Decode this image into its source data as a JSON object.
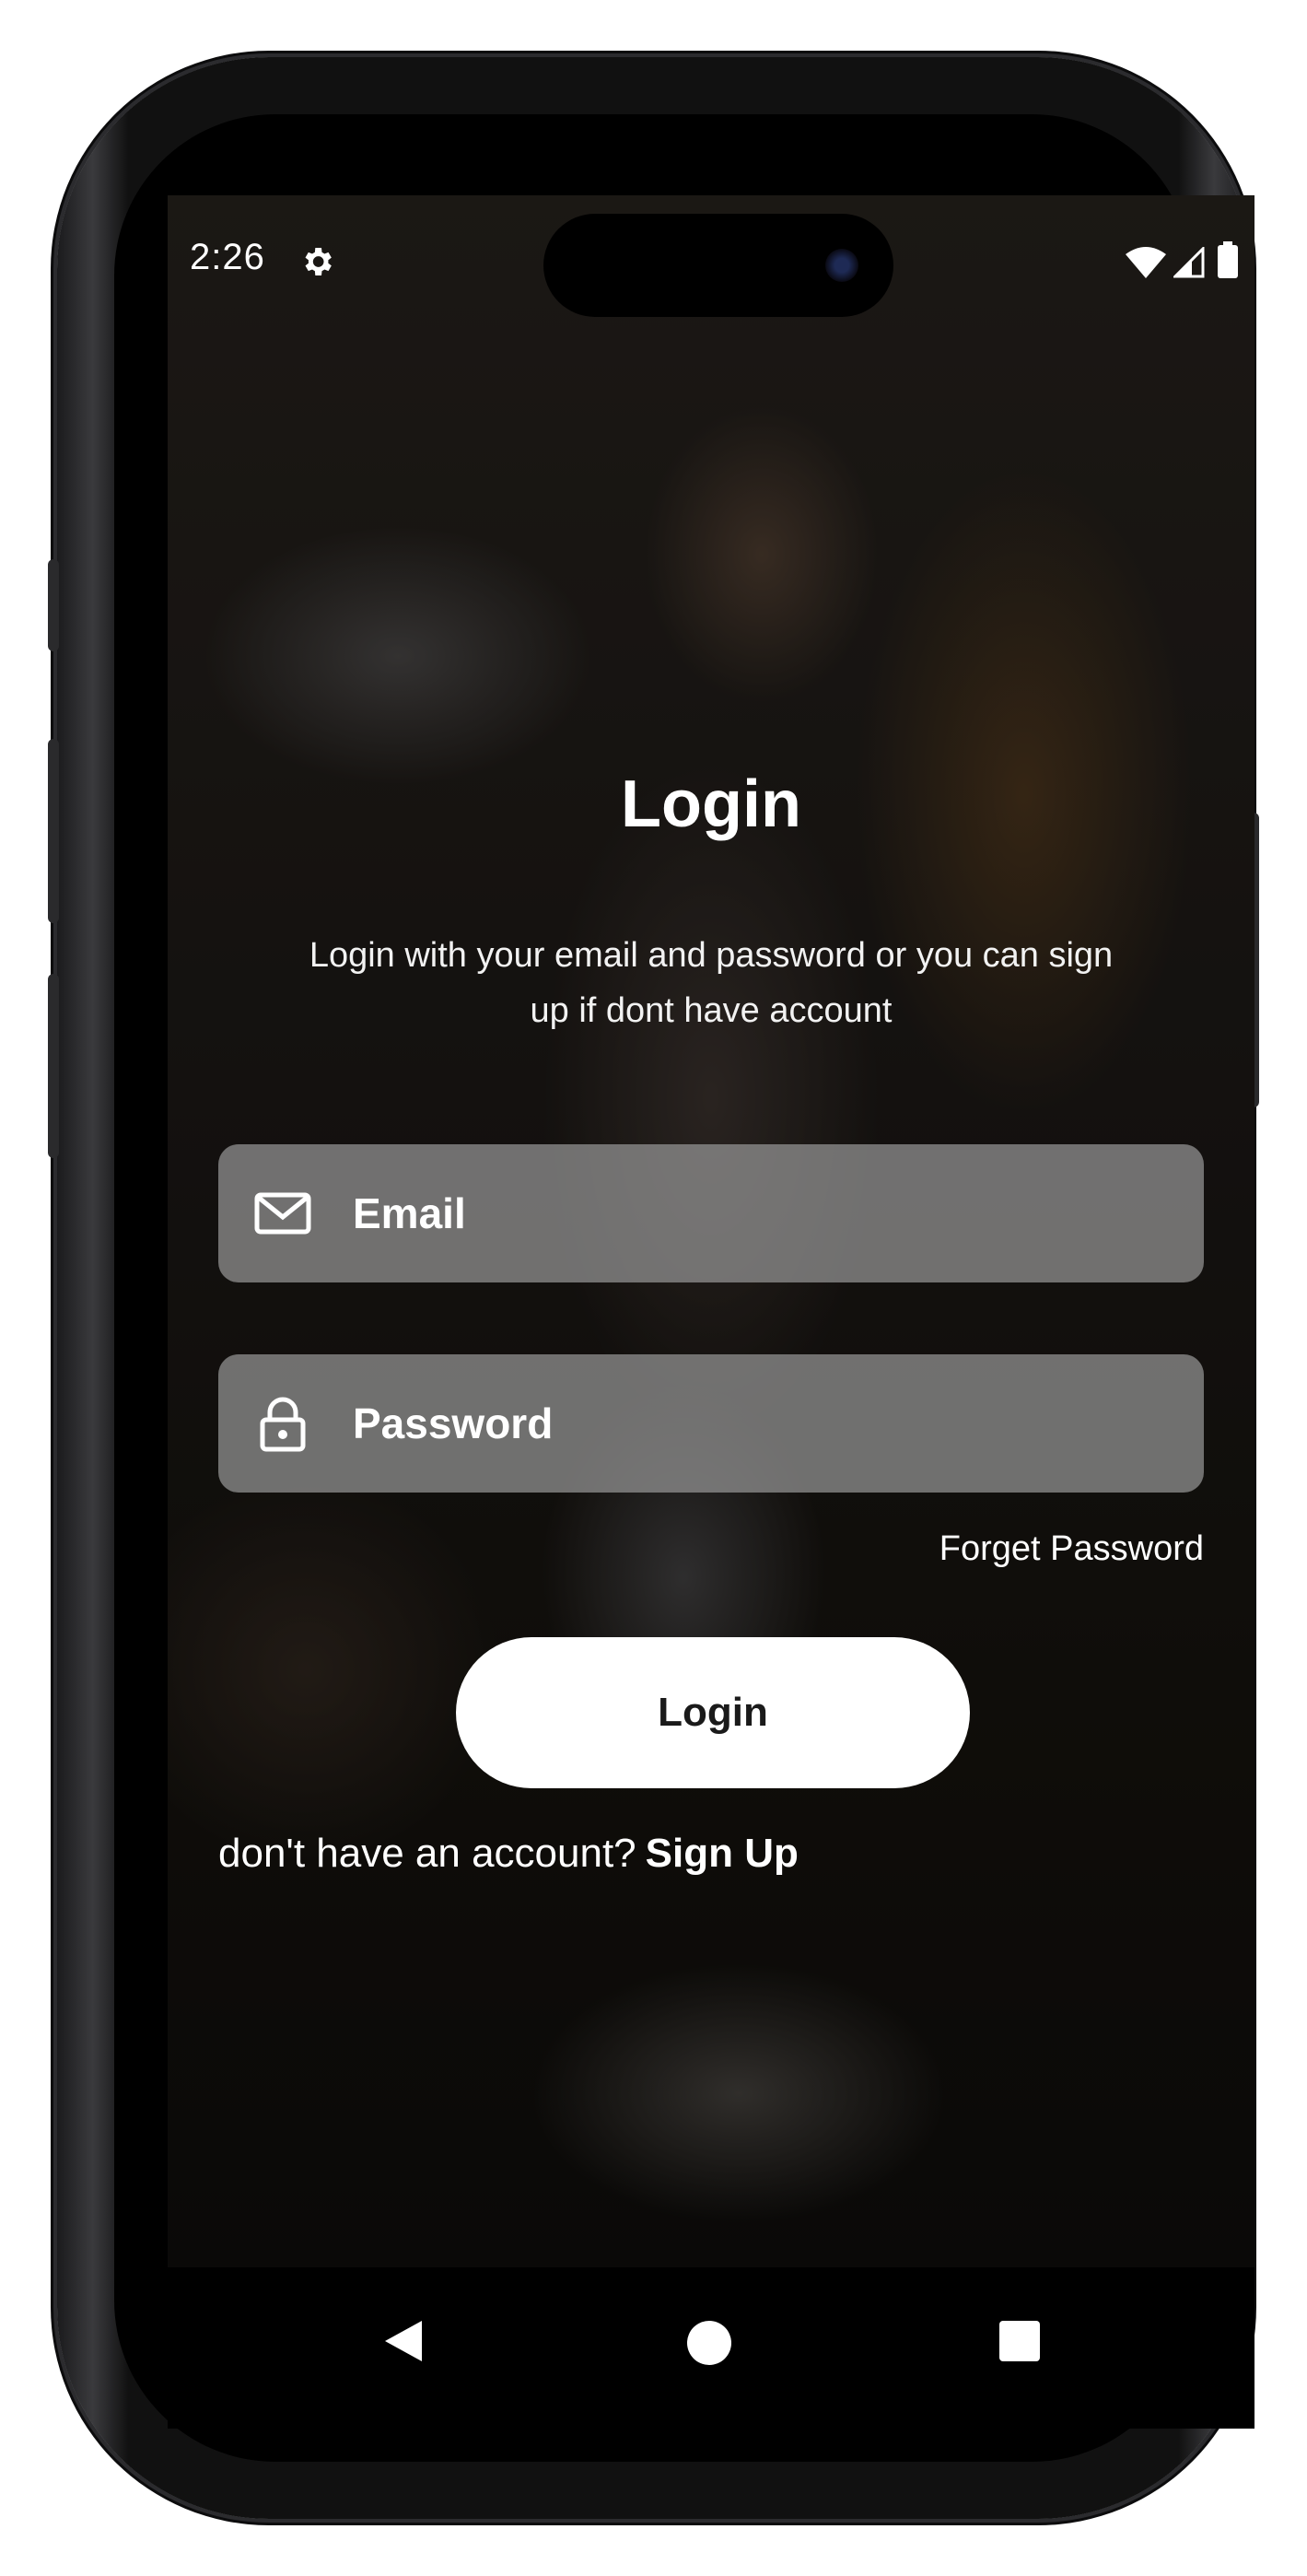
{
  "status_bar": {
    "time": "2:26",
    "icons": [
      "settings-icon",
      "wifi-icon",
      "signal-icon",
      "battery-icon"
    ]
  },
  "login": {
    "title": "Login",
    "subtitle": "Login with your email and password or you can sign\nup  if dont have account",
    "email": {
      "placeholder": "Email",
      "value": "",
      "icon": "mail-icon"
    },
    "password": {
      "placeholder": "Password",
      "value": "",
      "icon": "lock-icon"
    },
    "forgot_label": "Forget Password",
    "button_label": "Login",
    "signup_prompt": "don't have an account?",
    "signup_link": "Sign Up"
  },
  "nav_bar": {
    "icons": [
      "back-icon",
      "home-icon",
      "recents-icon"
    ]
  },
  "colors": {
    "field_background": "#969696",
    "button_background": "#ffffff",
    "text": "#ffffff"
  }
}
